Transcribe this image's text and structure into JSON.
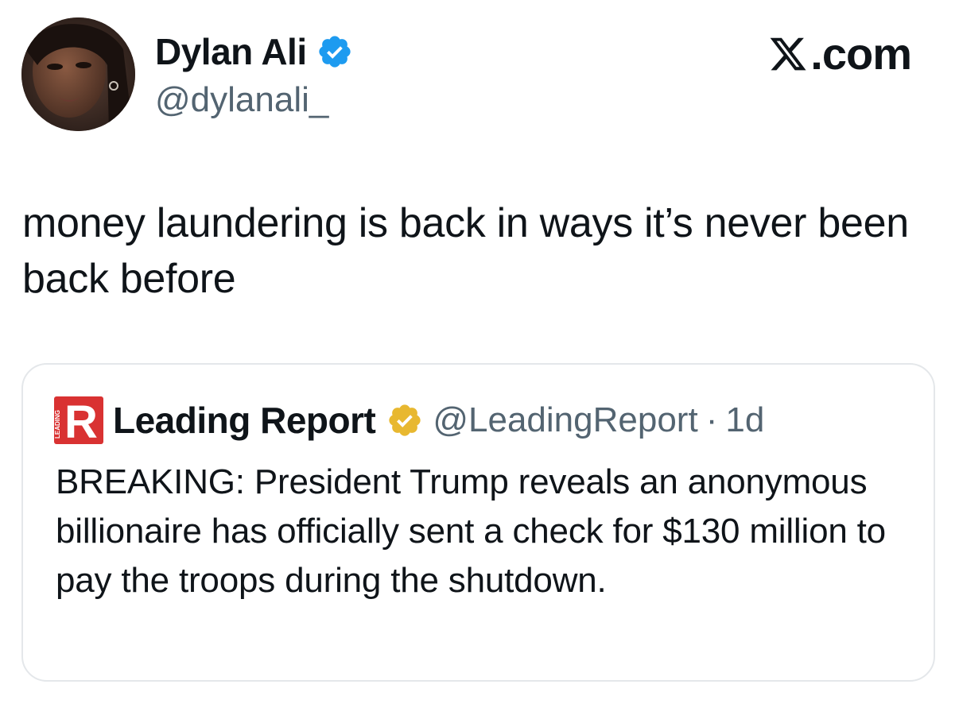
{
  "tweet": {
    "author": {
      "name": "Dylan Ali",
      "handle": "@dylanali_",
      "verified": true,
      "badge_color": "#1d9bf0"
    },
    "brand": ".com",
    "brand_icon": "x-logo-icon",
    "text": "money laundering is back in ways it’s never been back before"
  },
  "quoted_tweet": {
    "author": {
      "name": "Leading Report",
      "handle": "@LeadingReport",
      "badge": "gold-verified-icon",
      "badge_color": "#e8b830",
      "logo_letter": "R",
      "logo_small_text": "LEADING",
      "logo_color": "#d93232"
    },
    "separator": "·",
    "time": "1d",
    "text": "BREAKING: President Trump reveals an anonymous billionaire has officially sent a check for $130 million to pay the troops during the shutdown."
  },
  "colors": {
    "text_primary": "#0f1419",
    "text_secondary": "#536471",
    "card_border": "#e4e7ea"
  }
}
